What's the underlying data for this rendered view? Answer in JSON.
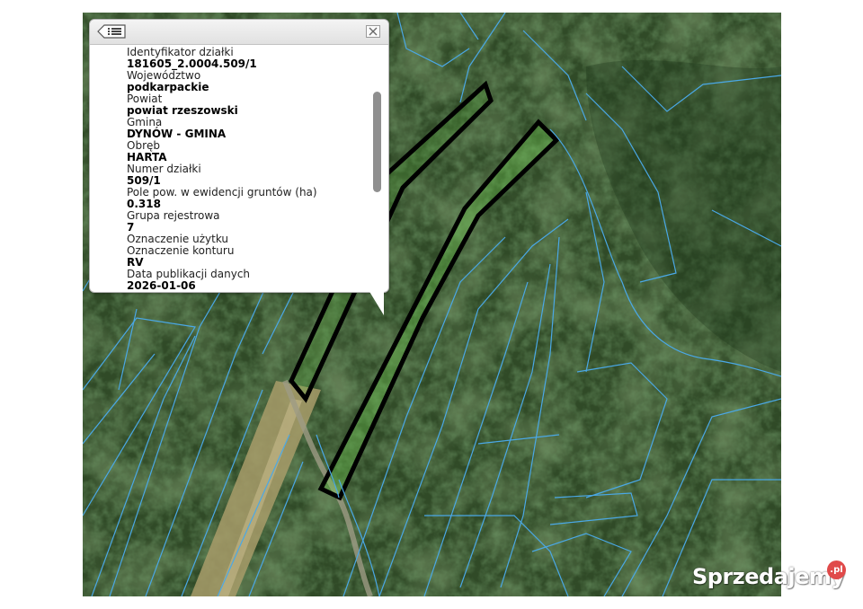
{
  "popup": {
    "fields": [
      {
        "label": "Identyfikator działki",
        "value": "181605_2.0004.509/1"
      },
      {
        "label": "Województwo",
        "value": "podkarpackie"
      },
      {
        "label": "Powiat",
        "value": "powiat rzeszowski"
      },
      {
        "label": "Gmina",
        "value": "DYNÓW - GMINA"
      },
      {
        "label": "Obręb",
        "value": "HARTA"
      },
      {
        "label": "Numer działki",
        "value": "509/1"
      },
      {
        "label": "Pole pow. w ewidencji gruntów (ha)",
        "value": "0.318"
      },
      {
        "label": "Grupa rejestrowa",
        "value": "7"
      },
      {
        "label": "Oznaczenie użytku",
        "value": ""
      },
      {
        "label": "Oznaczenie konturu",
        "value": "RV"
      },
      {
        "label": "Data publikacji danych",
        "value": "2026-01-06"
      }
    ]
  },
  "watermark": {
    "text": "Sprzedajemy",
    "badge": ".pl"
  },
  "colors": {
    "parcel_lines": "#4aa8e6",
    "selected_outline": "#000000",
    "selected_fill": "#6fd24f",
    "forest": "#2f4a26"
  },
  "icons": {
    "back": "list-back-icon",
    "close": "close-x-icon"
  }
}
